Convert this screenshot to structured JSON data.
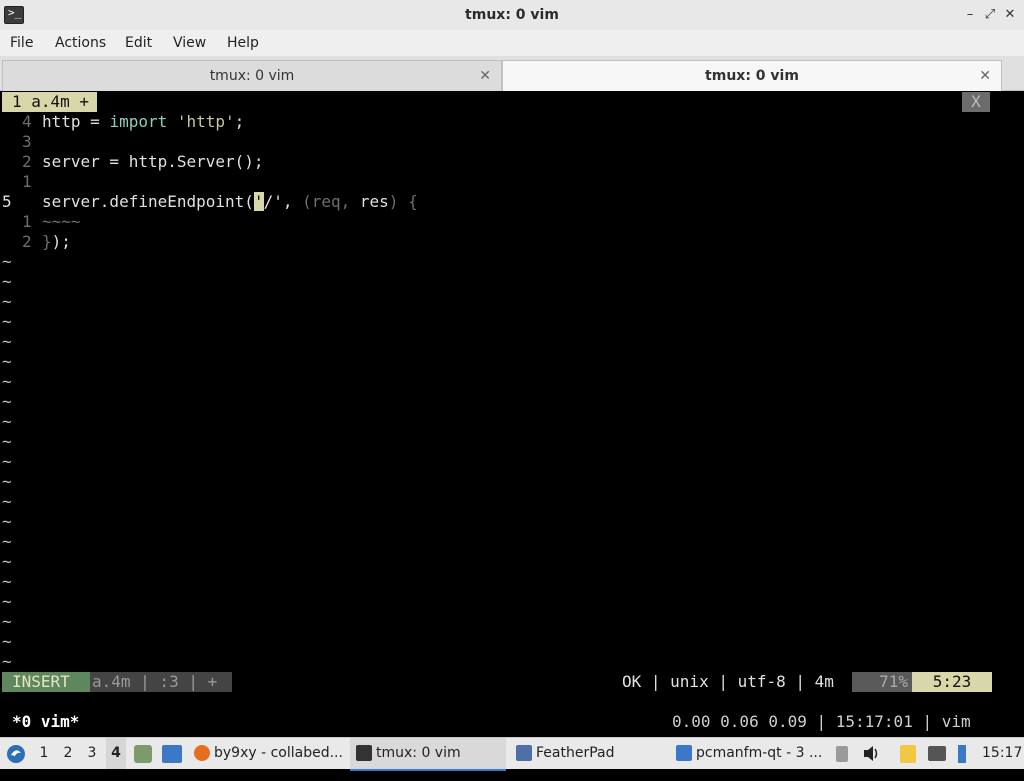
{
  "window": {
    "title": "tmux: 0 vim",
    "app_icon_glyph": ">_",
    "minimize": "–",
    "maximize": "⤢",
    "close": "✕"
  },
  "menu": [
    "File",
    "Actions",
    "Edit",
    "View",
    "Help"
  ],
  "tabs": [
    {
      "label": "tmux: 0 vim",
      "active": false
    },
    {
      "label": "tmux: 0 vim",
      "active": true
    }
  ],
  "tab_close_glyph": "✕",
  "vim": {
    "tabline": {
      "label": "1 a.4m +",
      "close": "X"
    },
    "lines": [
      {
        "num": "4",
        "parts": [
          [
            "ct",
            "http = "
          ],
          [
            "kw",
            "import"
          ],
          [
            "str",
            " 'http'"
          ],
          [
            "ct",
            ";"
          ]
        ]
      },
      {
        "num": "3",
        "parts": []
      },
      {
        "num": "2",
        "parts": [
          [
            "ct",
            "server = http.Server();"
          ]
        ]
      },
      {
        "num": "1",
        "parts": []
      },
      {
        "num": "5",
        "parts": [
          [
            "ct",
            "server.defineEndpoint("
          ],
          [
            "cur",
            "'"
          ],
          [
            "ct",
            "/', "
          ],
          [
            "dim",
            "(req, "
          ],
          [
            "ct",
            "res"
          ],
          [
            "dim",
            ") {"
          ]
        ]
      },
      {
        "num": "1",
        "parts": [
          [
            "dim",
            "~~~~"
          ]
        ]
      },
      {
        "num": "2",
        "parts": [
          [
            "dim",
            "}"
          ],
          [
            "ct",
            ");"
          ]
        ]
      }
    ],
    "tilde": "~",
    "status": {
      "mode": "INSERT",
      "file": "a.4m | :3 | +",
      "right": "OK | unix | utf-8 | 4m",
      "percent": "71%",
      "position": "5:23"
    }
  },
  "tmux": {
    "left": "*0 vim*",
    "right": "0.00 0.06 0.09 | 15:17:01 | vim"
  },
  "taskbar": {
    "workspaces": [
      "1",
      "2",
      "3",
      "4"
    ],
    "tasks": [
      {
        "label": "by9xy - collabed...",
        "icon": "firefox-icon"
      },
      {
        "label": "tmux: 0 vim",
        "icon": "terminal-icon"
      },
      {
        "label": "FeatherPad",
        "icon": "featherpad-icon"
      },
      {
        "label": "pcmanfm-qt - 3 ...",
        "icon": "folder-icon"
      }
    ],
    "clock": "15:17"
  }
}
